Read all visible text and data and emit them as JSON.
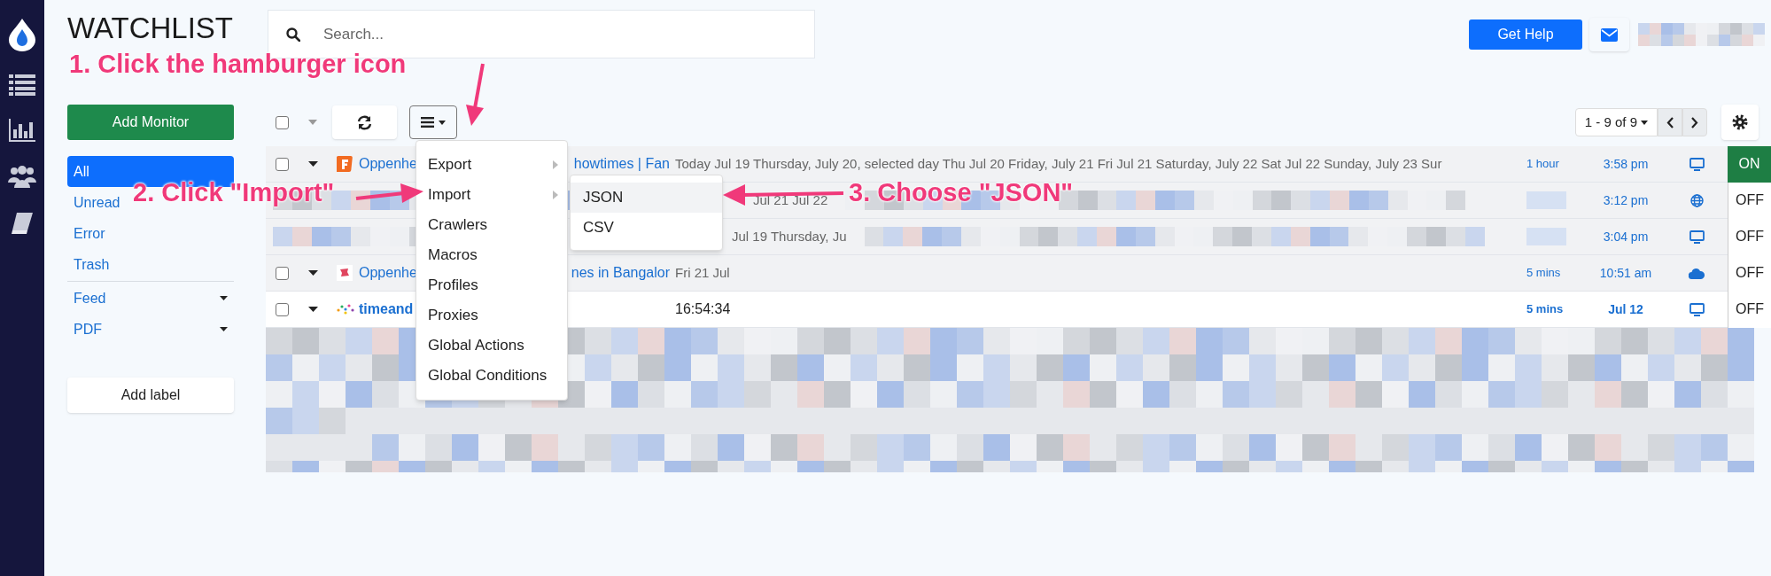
{
  "header": {
    "title": "WATCHLIST",
    "search": {
      "placeholder": "Search..."
    },
    "help_button": "Get Help"
  },
  "add_monitor": "Add Monitor",
  "filters": [
    {
      "label": "All",
      "selected": true,
      "dropdown": false
    },
    {
      "label": "Unread",
      "selected": false,
      "dropdown": false
    },
    {
      "label": "Error",
      "selected": false,
      "dropdown": false
    },
    {
      "label": "Trash",
      "selected": false,
      "dropdown": false
    },
    {
      "label": "Feed",
      "selected": false,
      "dropdown": true
    },
    {
      "label": "PDF",
      "selected": false,
      "dropdown": true
    }
  ],
  "add_label": "Add label",
  "pagination": {
    "range": "1 - 9 of 9"
  },
  "select_all": {
    "checked": false
  },
  "menu": {
    "items": [
      {
        "label": "Export",
        "submenu": true
      },
      {
        "label": "Import",
        "submenu": true
      },
      {
        "label": "Crawlers",
        "submenu": false
      },
      {
        "label": "Macros",
        "submenu": false
      },
      {
        "label": "Profiles",
        "submenu": false
      },
      {
        "label": "Proxies",
        "submenu": false
      },
      {
        "label": "Global Actions",
        "submenu": false
      },
      {
        "label": "Global Conditions",
        "submenu": false
      }
    ]
  },
  "submenu": {
    "items": [
      {
        "label": "JSON",
        "selected": true
      },
      {
        "label": "CSV",
        "selected": false
      }
    ]
  },
  "rows": [
    {
      "kind": "monitor",
      "checked": false,
      "unread": false,
      "name_start": "Oppenhe",
      "name_end": "howtimes | Fan",
      "description": "Today Jul 19 Thursday, July 20, selected day Thu Jul 20 Friday, July 21 Fri Jul 21 Saturday, July 22 Sat Jul 22 Sunday, July 23 Sur",
      "duration": "1 hour",
      "time": "3:58 pm",
      "on": true,
      "status": "ON"
    },
    {
      "kind": "redacted",
      "description": "Jul 21 Jul 22",
      "time": "3:12 pm",
      "on": false,
      "status": "OFF"
    },
    {
      "kind": "redacted",
      "description": "Jul 19 Thursday, Ju",
      "time": "3:04 pm",
      "on": false,
      "status": "OFF"
    },
    {
      "kind": "monitor",
      "checked": false,
      "unread": false,
      "name_start": "Oppenhe",
      "name_end": "nes in Bangalor",
      "description": "Fri 21 Jul",
      "duration": "5 mins",
      "time": "10:51 am",
      "on": false,
      "status": "OFF"
    },
    {
      "kind": "monitor",
      "checked": false,
      "unread": true,
      "name_start": "timeand",
      "description": "16:54:34",
      "duration": "5 mins",
      "time": "Jul 12",
      "on": false,
      "status": "OFF"
    }
  ],
  "annotations": [
    {
      "text": "1. Click the hamburger icon"
    },
    {
      "text": "2. Click \"Import\""
    },
    {
      "text": "3. Choose \"JSON\""
    }
  ]
}
